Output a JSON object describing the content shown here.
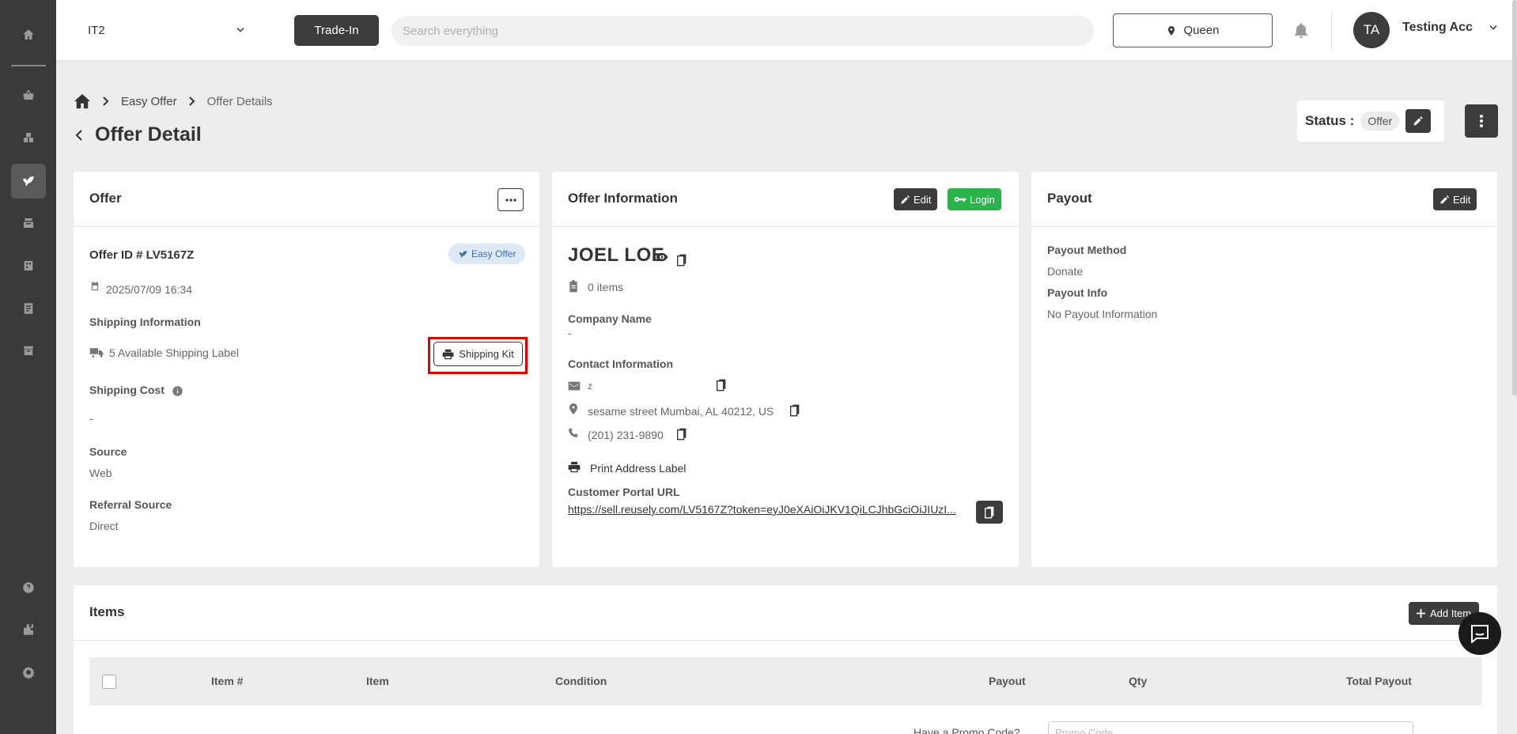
{
  "topbar": {
    "store": "IT2",
    "trade_in": "Trade-In",
    "search_placeholder": "Search everything",
    "location": "Queen",
    "avatar_initials": "TA",
    "user_name": "Testing Acc"
  },
  "breadcrumb": {
    "items": [
      "Easy Offer",
      "Offer Details"
    ]
  },
  "page": {
    "title": "Offer Detail",
    "status_label": "Status :",
    "status_value": "Offer"
  },
  "offer_card": {
    "title": "Offer",
    "offer_id": "Offer ID # LV5167Z",
    "badge": "Easy Offer",
    "date": "2025/07/09 16:34",
    "shipping_info_label": "Shipping Information",
    "shipping_labels": "5 Available Shipping Label",
    "shipping_kit": "Shipping Kit",
    "shipping_cost_label": "Shipping Cost",
    "shipping_cost": "-",
    "source_label": "Source",
    "source": "Web",
    "referral_label": "Referral Source",
    "referral": "Direct"
  },
  "info_card": {
    "title": "Offer Information",
    "edit": "Edit",
    "login": "Login",
    "customer_name": "JOEL LOE",
    "items_count": "0 items",
    "company_label": "Company Name",
    "company": "-",
    "contact_label": "Contact Information",
    "email": "z",
    "address": "sesame street Mumbai, AL 40212, US",
    "phone": "(201) 231-9890",
    "print_label": "Print Address Label",
    "portal_label": "Customer Portal URL",
    "portal_url": "https://sell.reusely.com/LV5167Z?token=eyJ0eXAiOiJKV1QiLCJhbGciOiJIUzI..."
  },
  "payout_card": {
    "title": "Payout",
    "edit": "Edit",
    "method_label": "Payout Method",
    "method": "Donate",
    "info_label": "Payout Info",
    "info": "No Payout Information"
  },
  "items_card": {
    "title": "Items",
    "add_item": "Add Item",
    "columns": [
      "Item #",
      "Item",
      "Condition",
      "Payout",
      "Qty",
      "Total Payout"
    ],
    "promo_label": "Have a Promo Code?",
    "promo_placeholder": "Promo Code"
  },
  "colors": {
    "sidebar": "#3a3a3a",
    "dark_button": "#3c3c3c",
    "green_button": "#2bb34b",
    "highlight": "#e00000"
  }
}
